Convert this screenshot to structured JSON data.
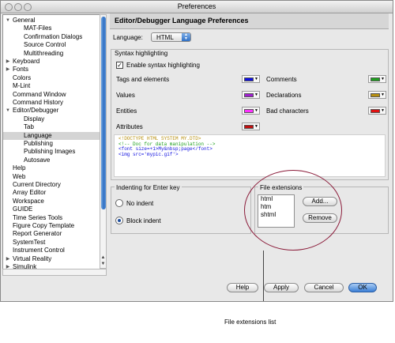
{
  "window": {
    "title": "Preferences"
  },
  "tree": {
    "items": [
      {
        "label": "General",
        "level": 0,
        "arrow": "down"
      },
      {
        "label": "MAT-Files",
        "level": 1
      },
      {
        "label": "Confirmation Dialogs",
        "level": 1
      },
      {
        "label": "Source Control",
        "level": 1
      },
      {
        "label": "Multithreading",
        "level": 1
      },
      {
        "label": "Keyboard",
        "level": 0,
        "arrow": "right"
      },
      {
        "label": "Fonts",
        "level": 0,
        "arrow": "right"
      },
      {
        "label": "Colors",
        "level": 0
      },
      {
        "label": "M-Lint",
        "level": 0
      },
      {
        "label": "Command Window",
        "level": 0
      },
      {
        "label": "Command History",
        "level": 0
      },
      {
        "label": "Editor/Debugger",
        "level": 0,
        "arrow": "down"
      },
      {
        "label": "Display",
        "level": 1
      },
      {
        "label": "Tab",
        "level": 1
      },
      {
        "label": "Language",
        "level": 1,
        "selected": true
      },
      {
        "label": "Publishing",
        "level": 1
      },
      {
        "label": "Publishing Images",
        "level": 1
      },
      {
        "label": "Autosave",
        "level": 1
      },
      {
        "label": "Help",
        "level": 0
      },
      {
        "label": "Web",
        "level": 0
      },
      {
        "label": "Current Directory",
        "level": 0
      },
      {
        "label": "Array Editor",
        "level": 0
      },
      {
        "label": "Workspace",
        "level": 0
      },
      {
        "label": "GUIDE",
        "level": 0
      },
      {
        "label": "Time Series Tools",
        "level": 0
      },
      {
        "label": "Figure Copy Template",
        "level": 0
      },
      {
        "label": "Report Generator",
        "level": 0
      },
      {
        "label": "SystemTest",
        "level": 0
      },
      {
        "label": "Instrument Control",
        "level": 0
      },
      {
        "label": "Virtual Reality",
        "level": 0,
        "arrow": "right"
      },
      {
        "label": "Simulink",
        "level": 0,
        "arrow": "right"
      }
    ]
  },
  "panel": {
    "header": "Editor/Debugger Language Preferences",
    "language_label": "Language:",
    "language_value": "HTML"
  },
  "syntax": {
    "group_title": "Syntax highlighting",
    "enable_label": "Enable syntax highlighting",
    "enabled": true,
    "left": [
      {
        "label": "Tags and elements",
        "color": "#1010e0"
      },
      {
        "label": "Values",
        "color": "#a020d0"
      },
      {
        "label": "Entities",
        "color": "#ff30ff"
      },
      {
        "label": "Attributes",
        "color": "#c01010"
      }
    ],
    "right": [
      {
        "label": "Comments",
        "color": "#20a020"
      },
      {
        "label": "Declarations",
        "color": "#b89010"
      },
      {
        "label": "Bad characters",
        "color": "#e01010"
      }
    ],
    "sample_lines": [
      {
        "text": "<!DOCTYPE HTML SYSTEM MY.DTD>",
        "color": "#b89010"
      },
      {
        "text": "<!-- Doc for data manipulation -->",
        "color": "#20a020"
      },
      {
        "text": "<font size=+1>My&nbsp;page</font>",
        "color": "#1010e0"
      },
      {
        "text": "<img src='mypic.gif'>",
        "color": "#1010e0"
      }
    ]
  },
  "indent": {
    "group_title": "Indenting for Enter key",
    "options": [
      {
        "label": "No indent",
        "selected": false
      },
      {
        "label": "Block indent",
        "selected": true
      }
    ]
  },
  "extensions": {
    "group_title": "File extensions",
    "items": [
      "html",
      "htm",
      "shtml"
    ],
    "add_label": "Add...",
    "remove_label": "Remove"
  },
  "buttons": {
    "help": "Help",
    "apply": "Apply",
    "cancel": "Cancel",
    "ok": "OK"
  },
  "annotation": {
    "caption": "File extensions list"
  }
}
